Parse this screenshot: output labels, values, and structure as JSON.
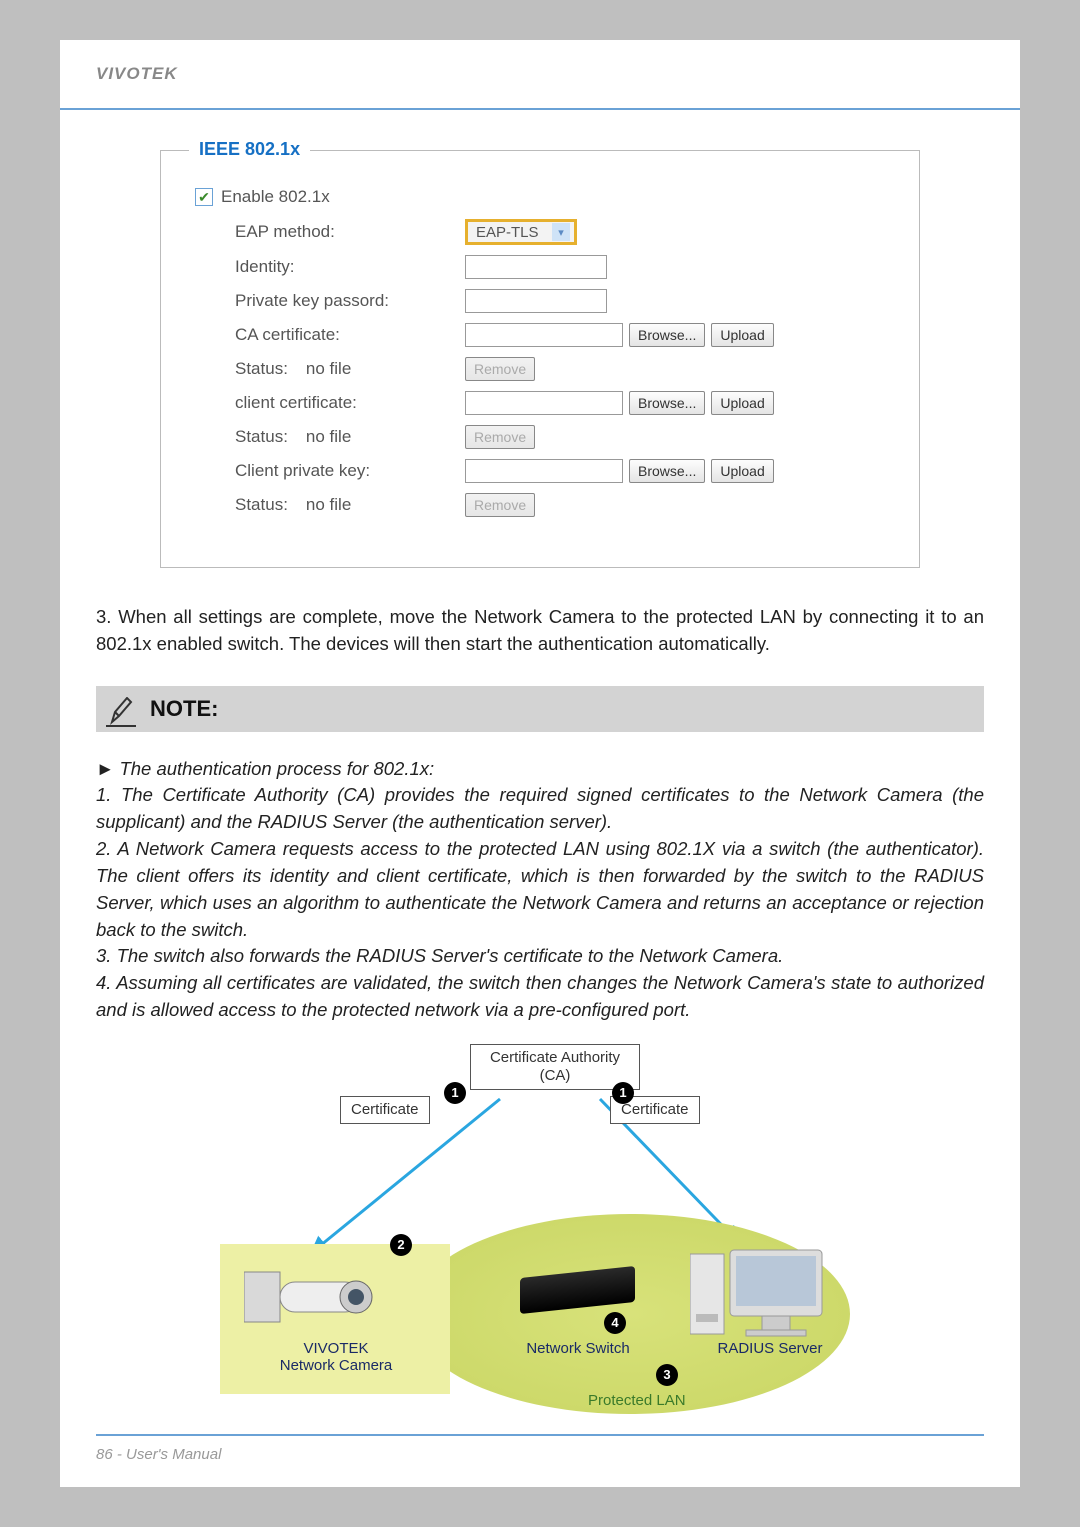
{
  "brand": "VIVOTEK",
  "panel": {
    "legend": "IEEE 802.1x",
    "enable_label": "Enable 802.1x",
    "rows": {
      "eap_method": {
        "label": "EAP method:",
        "value": "EAP-TLS"
      },
      "identity": {
        "label": "Identity:"
      },
      "pk_pass": {
        "label": "Private key passord:"
      },
      "ca_cert": {
        "label": "CA certificate:"
      },
      "client_cert": {
        "label": "client certificate:"
      },
      "client_key": {
        "label": "Client private key:"
      }
    },
    "status_label": "Status:",
    "status_value": "no file",
    "btn_browse": "Browse...",
    "btn_upload": "Upload",
    "btn_remove": "Remove"
  },
  "para3": "3. When all settings are complete, move the Network Camera to the protected LAN by connecting it to an 802.1x enabled switch. The devices will then start the authentication automatically.",
  "note_label": "NOTE:",
  "note": {
    "heading": "► The authentication process for 802.1x:",
    "n1": "1. The Certificate Authority (CA) provides the required signed certificates to the Network Camera (the supplicant) and the RADIUS Server (the authentication server).",
    "n2": "2. A Network Camera requests access to the protected LAN using 802.1X via a switch (the authenticator). The client offers its identity and client certificate, which is then forwarded by the switch to the RADIUS Server, which uses an algorithm to authenticate the Network Camera and returns an acceptance or rejection back to the switch.",
    "n3": "3. The switch also forwards the RADIUS Server's certificate to the Network Camera.",
    "n4": "4. Assuming all certificates are validated, the switch then changes the Network Camera's state to authorized and is allowed access to the protected network via a pre-configured port."
  },
  "diagram": {
    "ca": "Certificate Authority\n(CA)",
    "cert": "Certificate",
    "camera": "VIVOTEK\nNetwork Camera",
    "switch": "Network Switch",
    "radius": "RADIUS Server",
    "lan": "Protected LAN"
  },
  "footer": "86 - User's Manual"
}
